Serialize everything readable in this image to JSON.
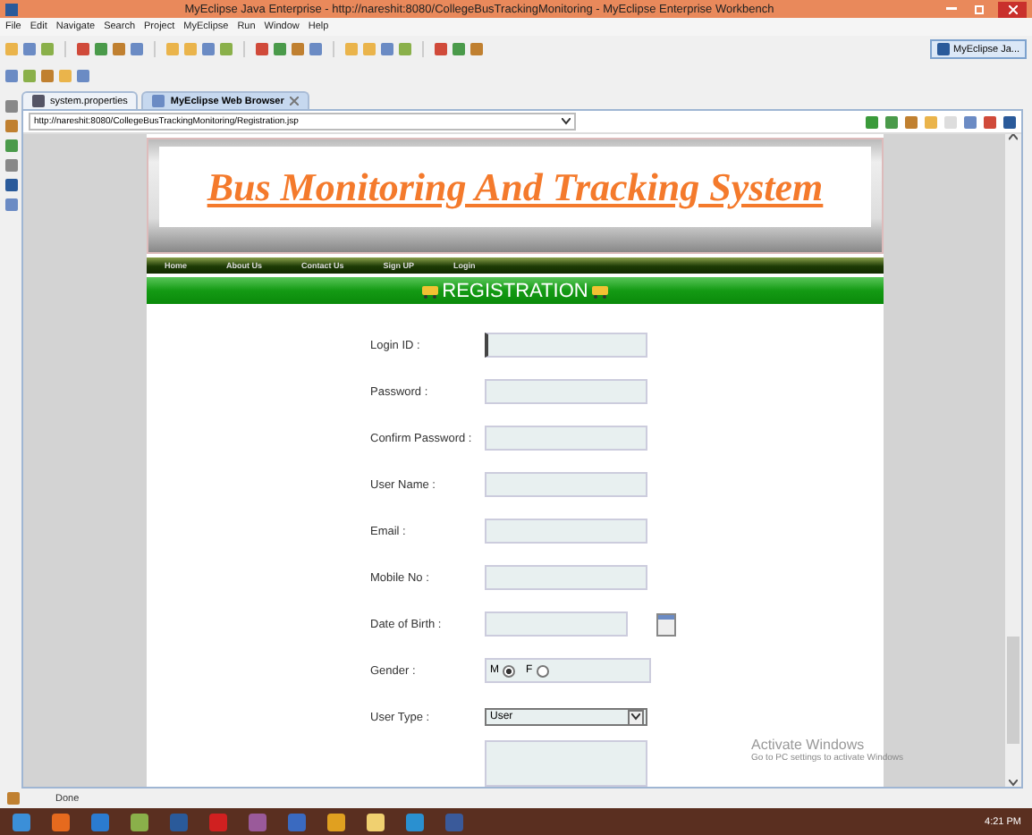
{
  "window": {
    "title": "MyEclipse Java Enterprise - http://nareshit:8080/CollegeBusTrackingMonitoring - MyEclipse Enterprise Workbench"
  },
  "menu": [
    "File",
    "Edit",
    "Navigate",
    "Search",
    "Project",
    "MyEclipse",
    "Run",
    "Window",
    "Help"
  ],
  "perspective": {
    "label": "MyEclipse Ja...",
    "selected": true
  },
  "tabs": [
    {
      "label": "system.properties",
      "selected": false,
      "closable": false
    },
    {
      "label": "MyEclipse Web Browser",
      "selected": true,
      "closable": true
    }
  ],
  "address_bar": {
    "url": "http://nareshit:8080/CollegeBusTrackingMonitoring/Registration.jsp"
  },
  "page": {
    "site_title": "Bus Monitoring And Tracking System",
    "nav": [
      "Home",
      "About Us",
      "Contact Us",
      "Sign UP",
      "Login"
    ],
    "section_title": "REGISTRATION",
    "fields": [
      {
        "label": "Login ID :",
        "kind": "text",
        "focused": true
      },
      {
        "label": "Password :",
        "kind": "text",
        "focused": false
      },
      {
        "label": "Confirm Password :",
        "kind": "text",
        "focused": false
      },
      {
        "label": "User Name :",
        "kind": "text",
        "focused": false
      },
      {
        "label": "Email :",
        "kind": "text",
        "focused": false
      },
      {
        "label": "Mobile No :",
        "kind": "text",
        "focused": false
      },
      {
        "label": "Date of Birth :",
        "kind": "date",
        "focused": false
      },
      {
        "label": "Gender :",
        "kind": "radio",
        "options": [
          {
            "label": "M",
            "selected": true
          },
          {
            "label": "F",
            "selected": false
          }
        ]
      },
      {
        "label": "User Type :",
        "kind": "select",
        "value": "User"
      },
      {
        "kind": "textarea"
      }
    ]
  },
  "status_bar": {
    "text": "Done"
  },
  "activation": {
    "title": "Activate Windows",
    "subtitle": "Go to PC settings to activate Windows"
  },
  "taskbar": {
    "time": "4:21 PM"
  }
}
